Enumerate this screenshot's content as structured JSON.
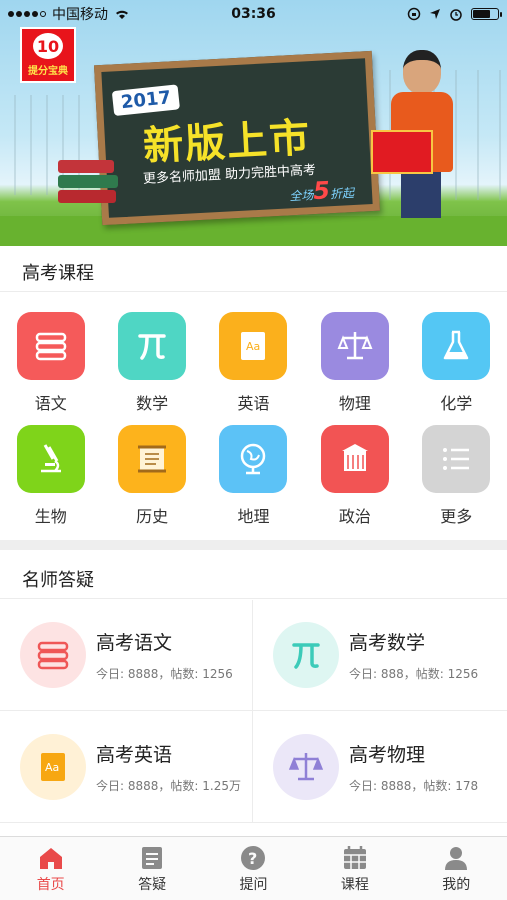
{
  "status_bar": {
    "carrier": "中国移动",
    "time": "03:36"
  },
  "banner": {
    "year": "2017",
    "headline": "新版上市",
    "subline": "更多名师加盟  助力完胜中高考",
    "promo_prefix": "全场",
    "promo_number": "5",
    "promo_suffix": "折起",
    "logo_number": "10",
    "logo_text": "提分宝典"
  },
  "courses": {
    "title": "高考课程",
    "items": [
      {
        "label": "语文",
        "icon": "books-icon",
        "color": "#f55a5a"
      },
      {
        "label": "数学",
        "icon": "pi-icon",
        "color": "#4fd6c4"
      },
      {
        "label": "英语",
        "icon": "english-book-icon",
        "color": "#fbb01c"
      },
      {
        "label": "物理",
        "icon": "scale-icon",
        "color": "#9a8ae0"
      },
      {
        "label": "化学",
        "icon": "flask-icon",
        "color": "#54c7f4"
      },
      {
        "label": "生物",
        "icon": "microscope-icon",
        "color": "#7fd41a"
      },
      {
        "label": "历史",
        "icon": "scroll-icon",
        "color": "#fdb31c"
      },
      {
        "label": "地理",
        "icon": "globe-icon",
        "color": "#5cc2f6"
      },
      {
        "label": "政治",
        "icon": "building-icon",
        "color": "#f25454"
      },
      {
        "label": "更多",
        "icon": "list-icon",
        "color": "#d4d4d4"
      }
    ]
  },
  "qa": {
    "title": "名师答疑",
    "items": [
      {
        "title": "高考语文",
        "stats": "今日: 8888，帖数: 1256",
        "icon": "books-icon",
        "bg": "#fde3e3",
        "fg": "#ef5757"
      },
      {
        "title": "高考数学",
        "stats": "今日: 888，帖数: 1256",
        "icon": "pi-icon",
        "bg": "#def6f2",
        "fg": "#3ccbb9"
      },
      {
        "title": "高考英语",
        "stats": "今日: 8888，帖数: 1.25万",
        "icon": "english-book-icon",
        "bg": "#fff1d6",
        "fg": "#f7a712"
      },
      {
        "title": "高考物理",
        "stats": "今日: 8888，帖数: 178",
        "icon": "scale-icon",
        "bg": "#ebe7f8",
        "fg": "#8f80d6"
      }
    ]
  },
  "tabbar": {
    "items": [
      {
        "label": "首页",
        "icon": "home-icon",
        "active": true
      },
      {
        "label": "答疑",
        "icon": "qa-list-icon",
        "active": false
      },
      {
        "label": "提问",
        "icon": "question-icon",
        "active": false
      },
      {
        "label": "课程",
        "icon": "calendar-icon",
        "active": false
      },
      {
        "label": "我的",
        "icon": "person-icon",
        "active": false
      }
    ],
    "active_color": "#e94a4a",
    "inactive_color": "#8a8a8a"
  }
}
